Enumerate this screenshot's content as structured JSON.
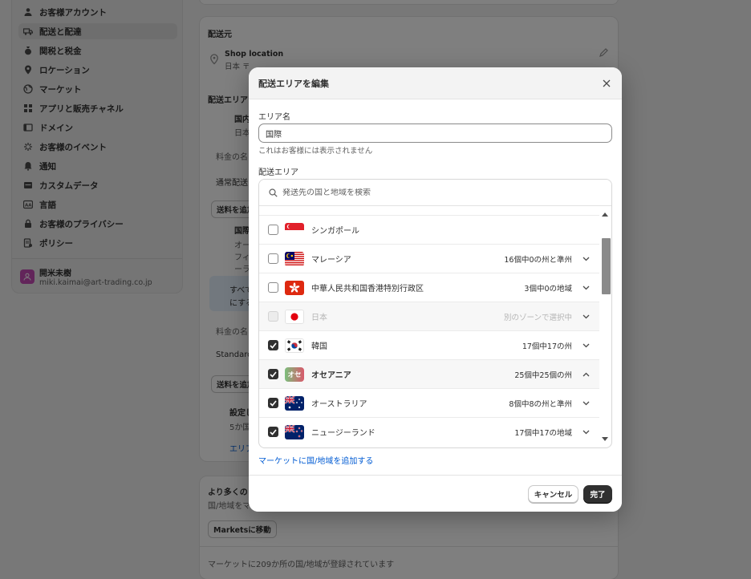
{
  "sidebar": {
    "items": [
      {
        "label": "お客様アカウント",
        "icon": "person-icon"
      },
      {
        "label": "配送と配達",
        "icon": "truck-icon",
        "active": true
      },
      {
        "label": "関税と税金",
        "icon": "tax-icon"
      },
      {
        "label": "ロケーション",
        "icon": "pin-icon"
      },
      {
        "label": "マーケット",
        "icon": "globe-icon"
      },
      {
        "label": "アプリと販売チャネル",
        "icon": "apps-icon"
      },
      {
        "label": "ドメイン",
        "icon": "domain-icon"
      },
      {
        "label": "お客様のイベント",
        "icon": "events-icon"
      },
      {
        "label": "通知",
        "icon": "bell-icon"
      },
      {
        "label": "カスタムデータ",
        "icon": "database-icon"
      },
      {
        "label": "言語",
        "icon": "language-icon"
      },
      {
        "label": "お客様のプライバシー",
        "icon": "lock-icon"
      },
      {
        "label": "ポリシー",
        "icon": "policy-icon"
      }
    ],
    "account": {
      "name": "開米未樹",
      "email": "miki.kaimai@art-trading.co.jp"
    }
  },
  "background": {
    "ship_from_title": "配送元",
    "shop_location": "Shop location",
    "shop_location_sub": "日本 〒",
    "area_title": "配送エリア",
    "domestic": "国内",
    "domestic_sub": "日本",
    "rate_name_1": "料金の名",
    "normal_ship": "通常配送",
    "add_rate_1": "送料を追加",
    "intl": "国際",
    "intl_line1": "オー",
    "intl_line2": "フィ",
    "intl_line3": "ーラ",
    "info_1": "すべて",
    "info_2": "にする",
    "rate_name_2": "料金の名",
    "standard": "Standard",
    "add_rate_2": "送料を追加",
    "unset": "設定し",
    "unset_sub": "5か国",
    "area_link": "エリア",
    "more_title": "より多くの",
    "more_sub": "国/地域をマ",
    "markets_btn": "Marketsに移動",
    "footer_text": "マーケットに209か所の国/地域が登録されています"
  },
  "modal": {
    "title": "配送エリアを編集",
    "area_name_label": "エリア名",
    "area_name_value": "国際",
    "area_name_help": "これはお客様には表示されません",
    "area_label": "配送エリア",
    "search_placeholder": "発送先の国と地域を検索",
    "add_link": "マーケットに国/地域を追加する",
    "cancel": "キャンセル",
    "done": "完了",
    "rows": [
      {
        "name": "シンガポール",
        "count": "",
        "checked": false,
        "flag": "singapore-flag-icon"
      },
      {
        "name": "マレーシア",
        "count": "16個中0の州と準州",
        "checked": false,
        "flag": "malaysia-flag-icon"
      },
      {
        "name": "中華人民共和国香港特別行政区",
        "count": "3個中0の地域",
        "checked": false,
        "flag": "hongkong-flag-icon"
      },
      {
        "name": "日本",
        "count": "別のゾーンで選択中",
        "checked": false,
        "disabled": true,
        "flag": "japan-flag-icon"
      },
      {
        "name": "韓国",
        "count": "17個中17の州",
        "checked": true,
        "flag": "korea-flag-icon"
      },
      {
        "name": "オセアニア",
        "count": "25個中25個の州",
        "checked": true,
        "group": true,
        "flag": "oceania-badge-icon",
        "badge": "オセ"
      },
      {
        "name": "オーストラリア",
        "count": "8個中8の州と準州",
        "checked": true,
        "flag": "australia-flag-icon"
      },
      {
        "name": "ニュージーランド",
        "count": "17個中17の地域",
        "checked": true,
        "flag": "newzealand-flag-icon"
      }
    ]
  },
  "colors": {
    "accent": "#005bd3",
    "dark": "#303030",
    "overlay": "rgba(0,0,0,0.5)"
  }
}
